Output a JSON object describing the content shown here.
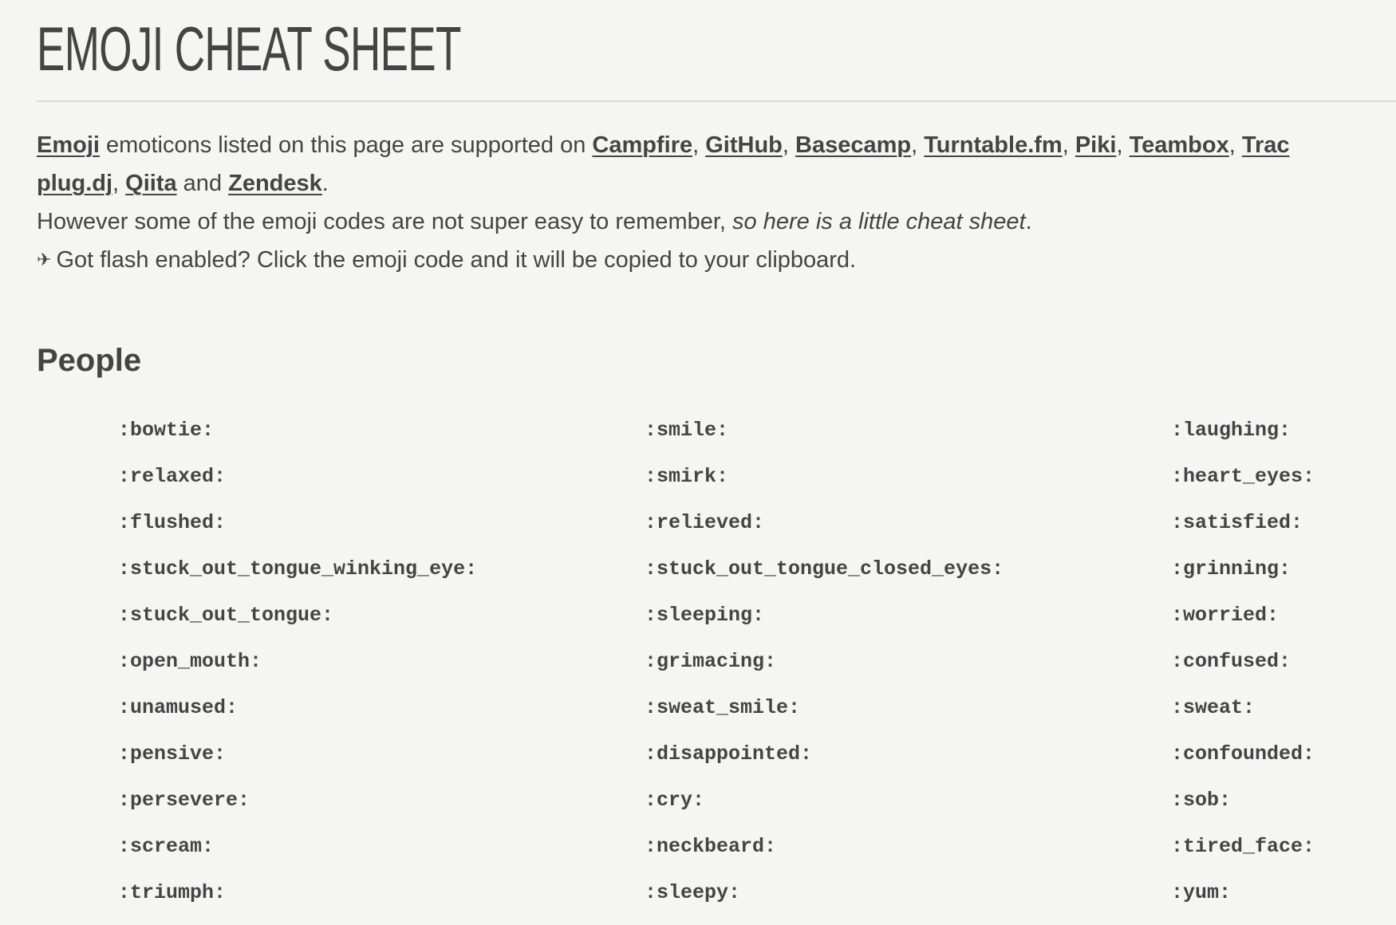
{
  "header": {
    "title": "EMOJI CHEAT SHEET"
  },
  "intro": {
    "line1": {
      "emoji_link": "Emoji",
      "text_a": " emoticons listed on this page are supported on ",
      "services": [
        "Campfire",
        "GitHub",
        "Basecamp",
        "Turntable.fm",
        "Piki",
        "Teambox",
        "Trac"
      ],
      "services_line2": [
        "plug.dj",
        "Qiita"
      ],
      "and": " and ",
      "last_service": "Zendesk",
      "period": "."
    },
    "line3": {
      "text": "However some of the emoji codes are not super easy to remember, ",
      "emphasis": "so here is a little cheat sheet",
      "period": "."
    },
    "line4": {
      "icon": "airplane-icon",
      "icon_glyph": "✈",
      "text": "Got flash enabled? Click the emoji code and it will be copied to your clipboard."
    }
  },
  "sections": [
    {
      "title": "People",
      "codes": [
        ":bowtie:",
        ":smile:",
        ":laughing:",
        ":relaxed:",
        ":smirk:",
        ":heart_eyes:",
        ":flushed:",
        ":relieved:",
        ":satisfied:",
        ":stuck_out_tongue_winking_eye:",
        ":stuck_out_tongue_closed_eyes:",
        ":grinning:",
        ":stuck_out_tongue:",
        ":sleeping:",
        ":worried:",
        ":open_mouth:",
        ":grimacing:",
        ":confused:",
        ":unamused:",
        ":sweat_smile:",
        ":sweat:",
        ":pensive:",
        ":disappointed:",
        ":confounded:",
        ":persevere:",
        ":cry:",
        ":sob:",
        ":scream:",
        ":neckbeard:",
        ":tired_face:",
        ":triumph:",
        ":sleepy:",
        ":yum:"
      ]
    }
  ]
}
